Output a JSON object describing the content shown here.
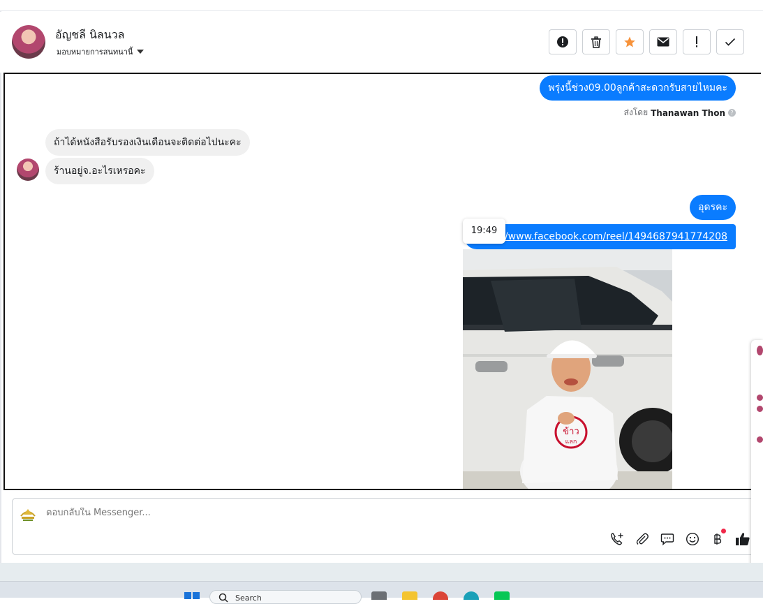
{
  "header": {
    "contact_name": "อัญชลี นิลนวล",
    "assign_label": "มอบหมายการสนทนานี้"
  },
  "toolbar": {
    "icons": [
      "alert-icon",
      "trash-icon",
      "star-icon",
      "mail-icon",
      "exclamation-icon",
      "check-icon"
    ],
    "star_color": "#f7923a"
  },
  "messages": {
    "out_1": "พรุ่งนี้ช่วง09.00ลูกค้าสะดวกรับสายไหมคะ",
    "sent_by_prefix": "ส่งโดย",
    "sent_by_name": "Thanawan Thon",
    "in_1": "ถ้าได้หนังสือรับรองเงินเดือนจะติดต่อไปนะคะ",
    "in_2": "ร้านอยู่จ.อะไรเหรอคะ",
    "out_2": "อุดรคะ",
    "out_link": "https://www.facebook.com/reel/1494687941774208",
    "tooltip_time": "19:49"
  },
  "composer": {
    "placeholder": "ตอบกลับใน Messenger...",
    "icons": [
      "call-add-icon",
      "attachment-icon",
      "chat-template-icon",
      "emoji-icon",
      "baht-icon",
      "thumbs-up-icon"
    ]
  },
  "taskbar": {
    "search_label": "Search"
  },
  "colors": {
    "accent": "#0a7cff",
    "bubble_in": "#f0f0f0"
  }
}
